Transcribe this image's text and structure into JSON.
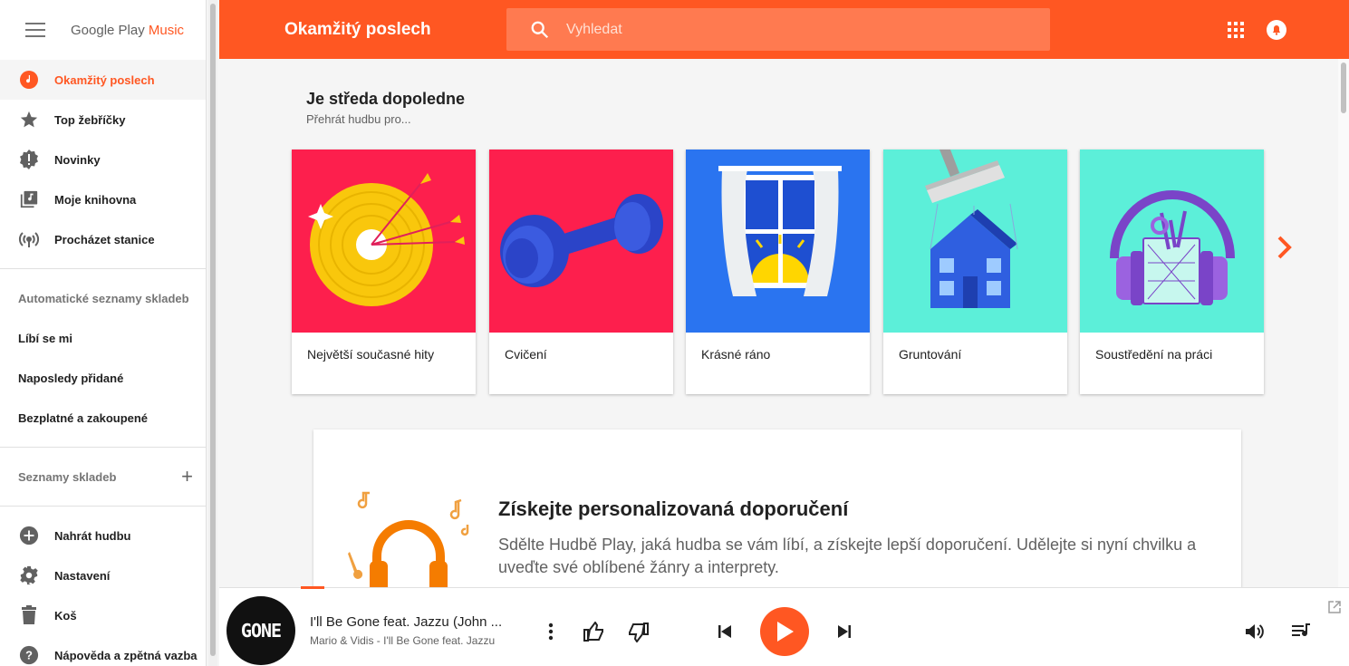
{
  "app": {
    "logo_text": "Google Play",
    "logo_accent": "Music",
    "accent_color": "#ff5722"
  },
  "sidebar": {
    "nav": [
      {
        "label": "Okamžitý poslech",
        "icon": "listen-now-icon",
        "active": true
      },
      {
        "label": "Top žebříčky",
        "icon": "star-icon"
      },
      {
        "label": "Novinky",
        "icon": "new-releases-icon"
      },
      {
        "label": "Moje knihovna",
        "icon": "library-music-icon"
      },
      {
        "label": "Procházet stanice",
        "icon": "radio-station-icon"
      }
    ],
    "auto_playlists_header": "Automatické seznamy skladeb",
    "auto_playlists": [
      "Líbí se mi",
      "Naposledy přidané",
      "Bezplatné a zakoupené"
    ],
    "playlists_header": "Seznamy skladeb",
    "footer": [
      {
        "label": "Nahrát hudbu",
        "icon": "upload-icon"
      },
      {
        "label": "Nastavení",
        "icon": "settings-gear-icon"
      },
      {
        "label": "Koš",
        "icon": "trash-icon"
      },
      {
        "label": "Nápověda a zpětná vazba",
        "icon": "help-icon"
      }
    ]
  },
  "topbar": {
    "title": "Okamžitý poslech",
    "search_placeholder": "Vyhledat"
  },
  "main": {
    "heading": "Je středa dopoledne",
    "subheading": "Přehrát hudbu pro...",
    "cards": [
      {
        "label": "Největší současné hity",
        "bg": "#fd1f4d"
      },
      {
        "label": "Cvičení",
        "bg": "#fd1f4d"
      },
      {
        "label": "Krásné ráno",
        "bg": "#2a74f0"
      },
      {
        "label": "Gruntování",
        "bg": "#5cefd9"
      },
      {
        "label": "Soustředění na práci",
        "bg": "#5cefd9"
      }
    ],
    "promo": {
      "title": "Získejte personalizovaná doporučení",
      "description": "Sdělte Hudbě Play, jaká hudba se vám líbí, a získejte lepší doporučení. Udělejte si nyní chvilku a uveďte své oblíbené žánry a interprety."
    }
  },
  "player": {
    "cover_text": "GONE",
    "track_title": "I'll Be Gone feat. Jazzu (John ...",
    "track_subtitle": "Mario & Vidis - I'll Be Gone feat. Jazzu"
  }
}
